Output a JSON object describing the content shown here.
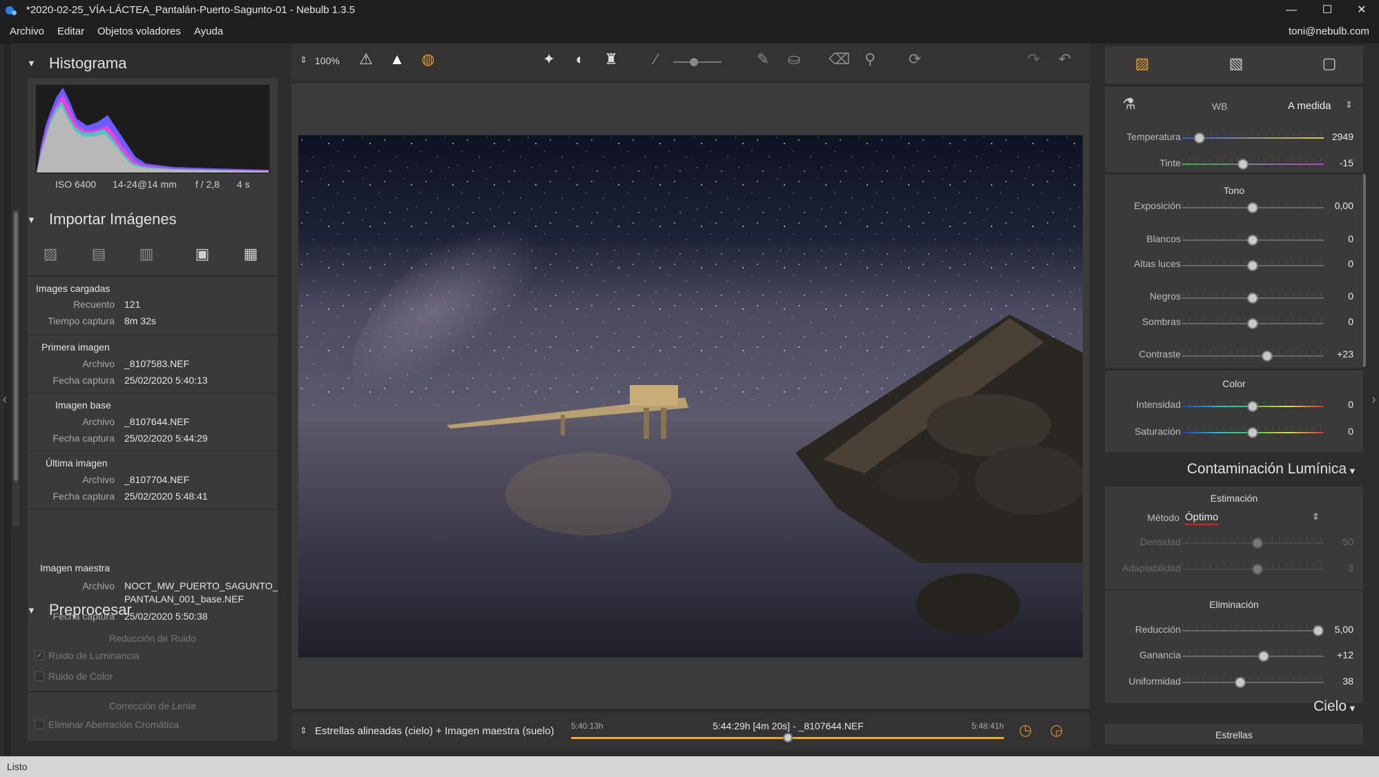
{
  "window": {
    "title": "*2020-02-25_VÍA-LÁCTEA_Pantalán-Puerto-Sagunto-01 - Nebulb 1.3.5",
    "min": "—",
    "max": "☐",
    "close": "✕"
  },
  "menu": {
    "items": [
      "Archivo",
      "Editar",
      "Objetos voladores",
      "Ayuda"
    ],
    "user": "toni@nebulb.com"
  },
  "left": {
    "histogram": {
      "title": "Histograma",
      "iso": "ISO 6400",
      "lens": "14-24@14 mm",
      "aperture": "f / 2,8",
      "shutter": "4 s"
    },
    "import": {
      "title": "Importar Imágenes",
      "loaded": {
        "heading": "Images cargadas",
        "count_label": "Recuento",
        "count": "121",
        "time_label": "Tiempo captura",
        "time": "8m 32s"
      },
      "first": {
        "heading": "Primera imagen",
        "file_label": "Archivo",
        "file": "_8107583.NEF",
        "date_label": "Fecha captura",
        "date": "25/02/2020 5:40:13"
      },
      "base": {
        "heading": "Imagen base",
        "file_label": "Archivo",
        "file": "_8107644.NEF",
        "date_label": "Fecha captura",
        "date": "25/02/2020 5:44:29"
      },
      "last": {
        "heading": "Última imagen",
        "file_label": "Archivo",
        "file": "_8107704.NEF",
        "date_label": "Fecha captura",
        "date": "25/02/2020 5:48:41"
      },
      "master": {
        "heading": "Imagen maestra",
        "file_label": "Archivo",
        "file1": "NOCT_MW_PUERTO_SAGUNTO_",
        "file2": "PANTALAN_001_base.NEF",
        "date_label": "Fecha captura",
        "date": "25/02/2020 5:50:38"
      }
    },
    "preprocess": {
      "title": "Preprocesar",
      "noise_heading": "Reducción de Ruido",
      "lum_noise": "Ruido de Luminancia",
      "color_noise": "Ruido de Color",
      "lens_heading": "Corrección de Lente",
      "chromatic": "Eliminar Aberración Cromática"
    }
  },
  "toolbar": {
    "zoom": "100%"
  },
  "bottom": {
    "mode": "Estrellas alineadas (cielo) + Imagen maestra (suelo)",
    "start": "5:40:13h",
    "current": "5:44:29h [4m 20s] - _8107644.NEF",
    "end": "5:48:41h",
    "position": 0.5
  },
  "right": {
    "wb": {
      "label": "WB",
      "mode": "A medida",
      "temp_label": "Temperatura",
      "temp": "2949",
      "tint_label": "Tinte",
      "tint": "-15"
    },
    "tono": {
      "title": "Tono",
      "exp_label": "Exposición",
      "exp": "0,00",
      "whites_label": "Blancos",
      "whites": "0",
      "high_label": "Altas luces",
      "high": "0",
      "blacks_label": "Negros",
      "blacks": "0",
      "shadows_label": "Sombras",
      "shadows": "0",
      "contrast_label": "Contraste",
      "contrast": "+23"
    },
    "color": {
      "title": "Color",
      "int_label": "Intensidad",
      "int": "0",
      "sat_label": "Saturación",
      "sat": "0"
    },
    "contam": {
      "title": "Contaminación Lumínica",
      "est_heading": "Estimación",
      "method_label": "Método",
      "method": "Óptimo",
      "density_label": "Densidad",
      "density": "50",
      "adapt_label": "Adaptabilidad",
      "adapt": "3",
      "elim_heading": "Eliminación",
      "red_label": "Reducción",
      "red": "5,00",
      "gain_label": "Ganancia",
      "gain": "+12",
      "unif_label": "Uniformidad",
      "unif": "38"
    },
    "sky": {
      "title": "Cielo",
      "stars": "Estrellas"
    }
  },
  "status": {
    "text": "Listo"
  },
  "colors": {
    "accent": "#e0a030",
    "timeline": "#f0a820",
    "method_underline": "#e02020"
  }
}
